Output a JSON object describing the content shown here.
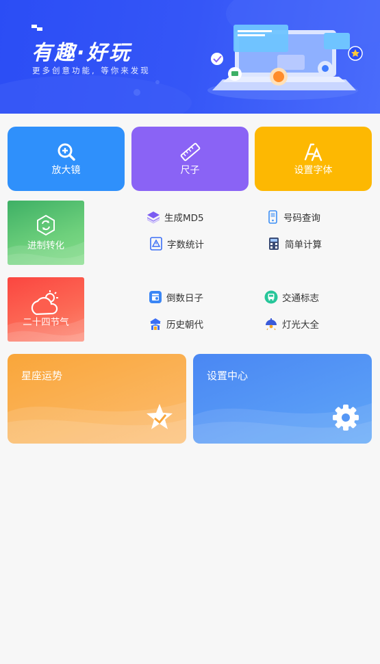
{
  "banner": {
    "title": "有趣·好玩",
    "subtitle": "更多创意功能, 等你来发现"
  },
  "top_cards": [
    {
      "label": "放大镜",
      "icon": "magnifier-icon",
      "color": "#2f90fb"
    },
    {
      "label": "尺子",
      "icon": "ruler-icon",
      "color": "#8a63f5"
    },
    {
      "label": "设置字体",
      "icon": "font-icon",
      "color": "#fdb802"
    }
  ],
  "section1": {
    "tile_label": "进制转化",
    "tile_icon": "hexagon-convert-icon",
    "links": [
      {
        "label": "生成MD5",
        "icon": "layers-icon"
      },
      {
        "label": "号码查询",
        "icon": "phone-icon"
      },
      {
        "label": "字数统计",
        "icon": "text-count-icon"
      },
      {
        "label": "简单计算",
        "icon": "calculator-icon"
      }
    ]
  },
  "section2": {
    "tile_label": "二十四节气",
    "tile_icon": "weather-sun-cloud-icon",
    "links": [
      {
        "label": "倒数日子",
        "icon": "calendar-icon"
      },
      {
        "label": "交通标志",
        "icon": "bus-icon"
      },
      {
        "label": "历史朝代",
        "icon": "pavilion-icon"
      },
      {
        "label": "灯光大全",
        "icon": "lamp-icon"
      }
    ]
  },
  "bottom_cards": [
    {
      "label": "星座运势",
      "icon": "star-icon",
      "color": "#f9a63a"
    },
    {
      "label": "设置中心",
      "icon": "gear-icon",
      "color": "#4a87f3"
    }
  ]
}
